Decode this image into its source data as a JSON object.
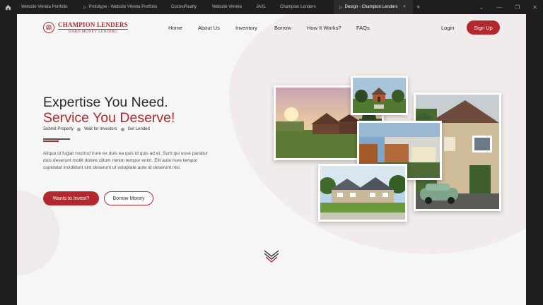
{
  "tabs": [
    {
      "label": "Website Vikreta Portfolio",
      "icon": "",
      "active": false
    },
    {
      "label": "Prototype - Website Vikreta Portfolio",
      "icon": "play-icon",
      "active": false
    },
    {
      "label": "CosmoRealty",
      "icon": "",
      "active": false
    },
    {
      "label": "Website Vikreta",
      "icon": "",
      "active": false
    },
    {
      "label": "JAXL",
      "icon": "",
      "active": false
    },
    {
      "label": "Champion Lenders",
      "icon": "",
      "active": false
    },
    {
      "label": "Design - Champion Lenders",
      "icon": "play-icon",
      "active": true
    }
  ],
  "tab_close": "×",
  "tab_add": "+",
  "window_controls": {
    "chevron": "⌄",
    "minimize": "—",
    "restore": "❐",
    "close": "✕"
  },
  "brand": {
    "title": "CHAMPION LENDERS",
    "subtitle": "HARD MONEY LENDING",
    "accent": "#b3282d"
  },
  "nav": {
    "items": [
      "Home",
      "About Us",
      "Inventory",
      "Borrow",
      "How It Works?",
      "FAQs"
    ],
    "login": "Login",
    "signup": "Sign Up"
  },
  "hero": {
    "line1": "Expertise You Need.",
    "line2": "Service You Deserve!",
    "steps": [
      "Submit Property",
      "Wait for Investors",
      "Get Lended"
    ],
    "paragraph": "Aliqua id fugiat nostrud irure ex duis ea quis id quis ad et. Sunt qui esse pariatur duis deserunt mollit dolore cillum minim tempor enim. Elit aute irure tempor cupidatat incididunt sint deserunt ut voluptate aute id deserunt nisi.",
    "cta_primary": "Wants to Invest?",
    "cta_secondary": "Borrow Money"
  },
  "colors": {
    "accent": "#b3282d",
    "background": "#f7f6f6",
    "blob": "#f1eceb"
  },
  "icons": [
    "home-icon",
    "play-icon",
    "chevron-down-icon",
    "scroll-down-chevrons-icon"
  ]
}
